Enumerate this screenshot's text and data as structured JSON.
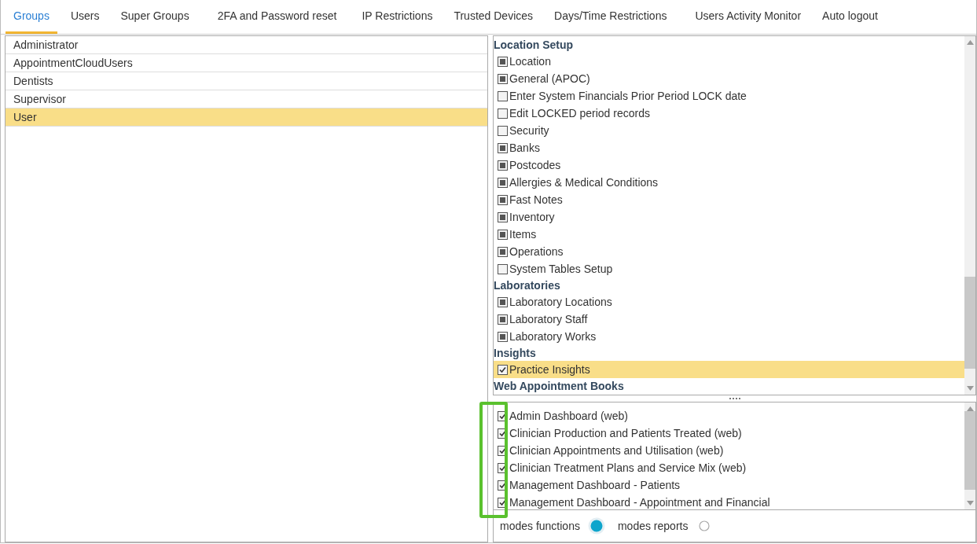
{
  "tabs": [
    {
      "label": "Groups",
      "selected": true
    },
    {
      "label": "Users",
      "selected": false
    },
    {
      "label": "Super Groups",
      "selected": false
    },
    {
      "label": "2FA and Password reset",
      "selected": false
    },
    {
      "label": "IP Restrictions",
      "selected": false
    },
    {
      "label": "Trusted Devices",
      "selected": false
    },
    {
      "label": "Days/Time Restrictions",
      "selected": false
    },
    {
      "label": "Users Activity Monitor",
      "selected": false
    },
    {
      "label": "Auto logout",
      "selected": false
    }
  ],
  "groups": {
    "items": [
      {
        "label": "Administrator",
        "selected": false
      },
      {
        "label": "AppointmentCloudUsers",
        "selected": false
      },
      {
        "label": "Dentists",
        "selected": false
      },
      {
        "label": "Supervisor",
        "selected": false
      },
      {
        "label": "User",
        "selected": true
      }
    ]
  },
  "permissions": {
    "items": [
      {
        "kind": "header",
        "label": "Location Setup"
      },
      {
        "kind": "item",
        "label": "Location",
        "checked": false,
        "partial": true,
        "selected": false
      },
      {
        "kind": "item",
        "label": "General (APOC)",
        "checked": false,
        "partial": true,
        "selected": false
      },
      {
        "kind": "item",
        "label": "Enter System Financials Prior Period LOCK date",
        "checked": false,
        "partial": false,
        "selected": false
      },
      {
        "kind": "item",
        "label": "Edit LOCKED period records",
        "checked": false,
        "partial": false,
        "selected": false
      },
      {
        "kind": "item",
        "label": "Security",
        "checked": false,
        "partial": false,
        "selected": false
      },
      {
        "kind": "item",
        "label": "Banks",
        "checked": false,
        "partial": true,
        "selected": false
      },
      {
        "kind": "item",
        "label": "Postcodes",
        "checked": false,
        "partial": true,
        "selected": false
      },
      {
        "kind": "item",
        "label": "Allergies & Medical Conditions",
        "checked": false,
        "partial": true,
        "selected": false
      },
      {
        "kind": "item",
        "label": "Fast Notes",
        "checked": false,
        "partial": true,
        "selected": false
      },
      {
        "kind": "item",
        "label": "Inventory",
        "checked": false,
        "partial": true,
        "selected": false
      },
      {
        "kind": "item",
        "label": "Items",
        "checked": false,
        "partial": true,
        "selected": false
      },
      {
        "kind": "item",
        "label": "Operations",
        "checked": false,
        "partial": true,
        "selected": false
      },
      {
        "kind": "item",
        "label": "System Tables Setup",
        "checked": false,
        "partial": false,
        "selected": false
      },
      {
        "kind": "header",
        "label": "Laboratories"
      },
      {
        "kind": "item",
        "label": "Laboratory Locations",
        "checked": false,
        "partial": true,
        "selected": false
      },
      {
        "kind": "item",
        "label": "Laboratory Staff",
        "checked": false,
        "partial": true,
        "selected": false
      },
      {
        "kind": "item",
        "label": "Laboratory Works",
        "checked": false,
        "partial": true,
        "selected": false
      },
      {
        "kind": "header",
        "label": "Insights"
      },
      {
        "kind": "item",
        "label": "Practice Insights",
        "checked": true,
        "partial": false,
        "selected": true
      },
      {
        "kind": "header",
        "label": "Web Appointment Books"
      }
    ]
  },
  "details": {
    "highlight": true,
    "items": [
      {
        "label": "Admin Dashboard (web)",
        "checked": true
      },
      {
        "label": "Clinician Production and Patients Treated (web)",
        "checked": true
      },
      {
        "label": "Clinician Appointments and Utilisation (web)",
        "checked": true
      },
      {
        "label": "Clinician Treatment Plans and Service Mix (web)",
        "checked": true
      },
      {
        "label": "Management Dashboard - Patients",
        "checked": true
      },
      {
        "label": "Management Dashboard - Appointment and Financial",
        "checked": true
      }
    ]
  },
  "modes": [
    {
      "label": "modes functions",
      "selected": true
    },
    {
      "label": "modes reports",
      "selected": false
    }
  ]
}
